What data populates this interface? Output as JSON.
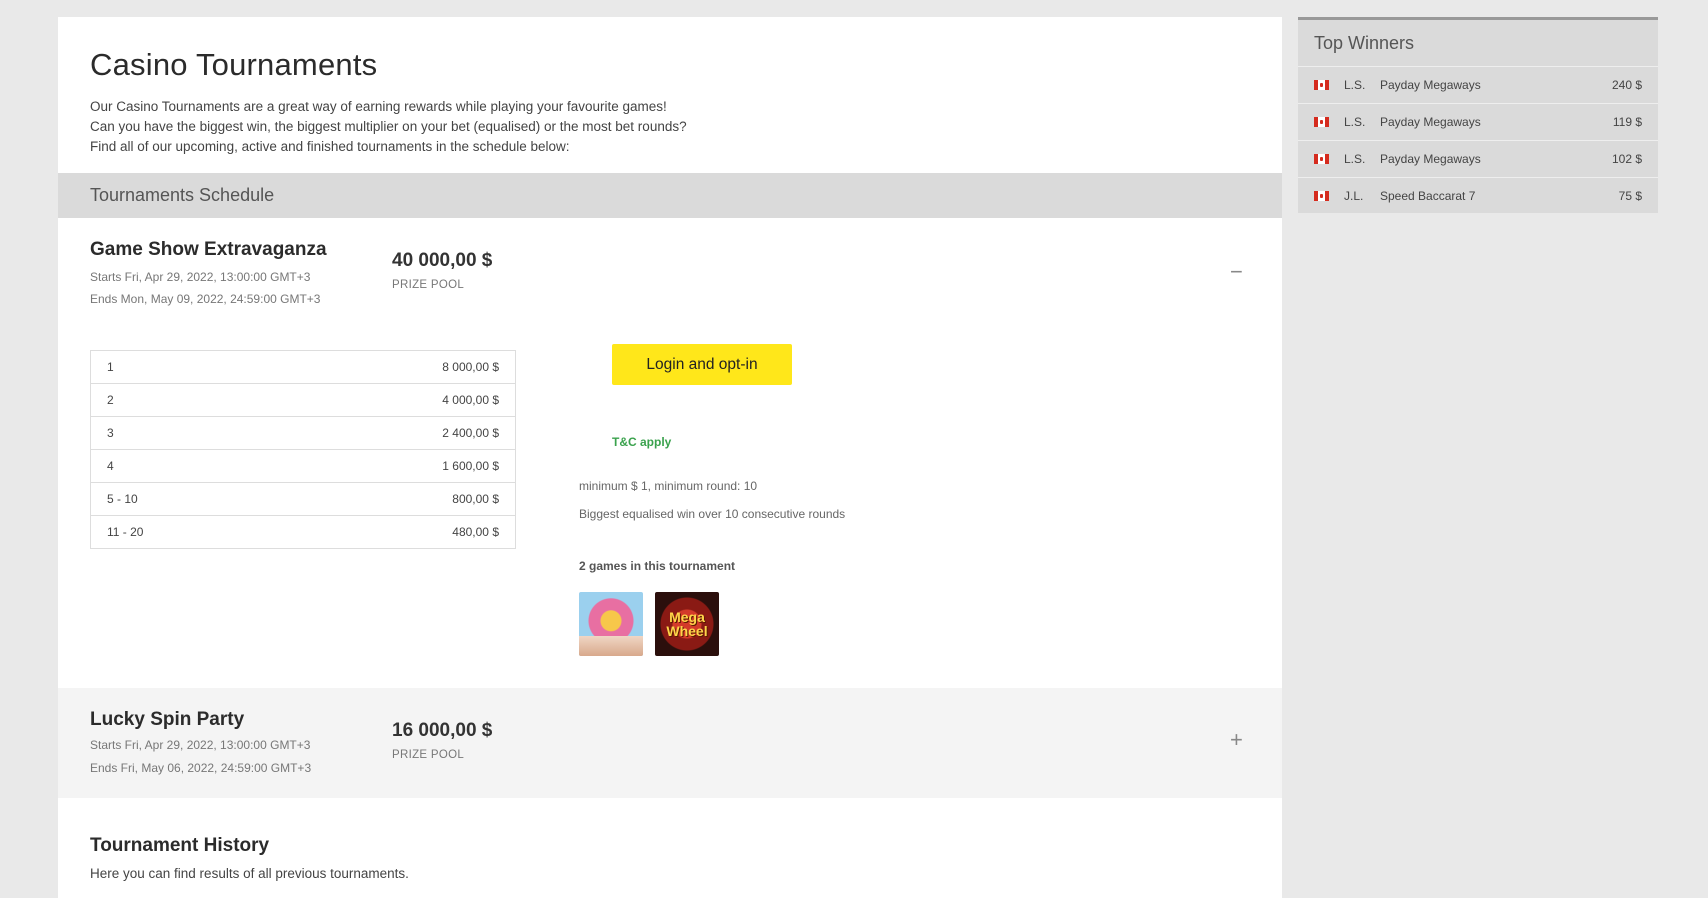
{
  "page": {
    "title": "Casino Tournaments",
    "intro": [
      "Our Casino Tournaments are a great way of earning rewards while playing your favourite games!",
      "Can you have the biggest win, the biggest multiplier on your bet (equalised) or the most bet rounds?",
      "Find all of our upcoming, active and finished tournaments in the schedule below:"
    ]
  },
  "schedule": {
    "title": "Tournaments Schedule"
  },
  "tournaments": [
    {
      "name": "Game Show Extravaganza",
      "starts": "Starts Fri, Apr 29, 2022, 13:00:00 GMT+3",
      "ends": "Ends Mon, May 09, 2022, 24:59:00 GMT+3",
      "prize": "40 000,00 $",
      "prize_label": "PRIZE POOL",
      "toggle": "−",
      "expanded": true,
      "ranks": [
        {
          "pos": "1",
          "amount": "8 000,00 $"
        },
        {
          "pos": "2",
          "amount": "4 000,00 $"
        },
        {
          "pos": "3",
          "amount": "2 400,00 $"
        },
        {
          "pos": "4",
          "amount": "1 600,00 $"
        },
        {
          "pos": "5 - 10",
          "amount": "800,00 $"
        },
        {
          "pos": "11 - 20",
          "amount": "480,00 $"
        }
      ],
      "login_button": "Login and opt-in",
      "tc_link": "T&C apply",
      "rule_1": "minimum $ 1, minimum round: 10",
      "rule_2": "Biggest equalised win over 10 consecutive rounds",
      "games_count": "2 games in this tournament",
      "games": [
        {
          "icon": "game-thumbnail-icon"
        },
        {
          "icon": "mega-wheel-thumbnail-icon",
          "text": "Mega Wheel"
        }
      ]
    },
    {
      "name": "Lucky Spin Party",
      "starts": "Starts Fri, Apr 29, 2022, 13:00:00 GMT+3",
      "ends": "Ends Fri, May 06, 2022, 24:59:00 GMT+3",
      "prize": "16 000,00 $",
      "prize_label": "PRIZE POOL",
      "toggle": "+",
      "expanded": false
    }
  ],
  "history": {
    "title": "Tournament History",
    "subtitle": "Here you can find results of all previous tournaments."
  },
  "top_winners": {
    "title": "Top Winners",
    "rows": [
      {
        "flag": "canada-flag-icon",
        "initials": "L.S.",
        "game": "Payday Megaways",
        "amount": "240 $"
      },
      {
        "flag": "canada-flag-icon",
        "initials": "L.S.",
        "game": "Payday Megaways",
        "amount": "119 $"
      },
      {
        "flag": "canada-flag-icon",
        "initials": "L.S.",
        "game": "Payday Megaways",
        "amount": "102 $"
      },
      {
        "flag": "canada-flag-icon",
        "initials": "J.L.",
        "game": "Speed Baccarat 7",
        "amount": "75 $"
      }
    ]
  },
  "colors": {
    "background": "#e9e9e9",
    "panel": "#ffffff",
    "header_bar": "#dadada",
    "cta": "#ffe71a",
    "tc_link": "#3aa24d"
  }
}
